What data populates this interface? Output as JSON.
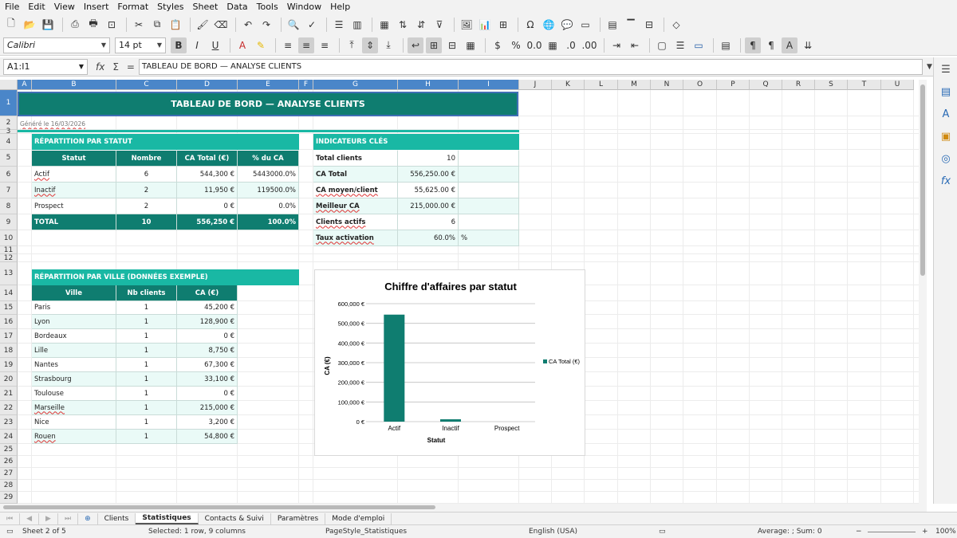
{
  "menu": [
    "File",
    "Edit",
    "View",
    "Insert",
    "Format",
    "Styles",
    "Sheet",
    "Data",
    "Tools",
    "Window",
    "Help"
  ],
  "toolbar": {
    "font_name": "Calibri",
    "font_size": "14 pt"
  },
  "formula_bar": {
    "name_box": "A1:I1",
    "content": "TABLEAU DE BORD — ANALYSE CLIENTS"
  },
  "columns": [
    "A",
    "B",
    "C",
    "D",
    "E",
    "F",
    "G",
    "H",
    "I",
    "J",
    "K",
    "L",
    "M",
    "N",
    "O",
    "P",
    "Q",
    "R",
    "S",
    "T",
    "U"
  ],
  "rows": [
    "1",
    "2",
    "3",
    "4",
    "5",
    "6",
    "7",
    "8",
    "9",
    "10",
    "11",
    "12",
    "13",
    "14",
    "15",
    "16",
    "17",
    "18",
    "19",
    "20",
    "21",
    "22",
    "23",
    "24",
    "25",
    "26",
    "27",
    "28",
    "29"
  ],
  "title": "TABLEAU DE BORD — ANALYSE CLIENTS",
  "generated": "Généré le 16/03/2026",
  "status_table": {
    "title": "RÉPARTITION PAR STATUT",
    "headers": [
      "Statut",
      "Nombre",
      "CA Total (€)",
      "% du CA"
    ],
    "rows": [
      [
        "Actif",
        "6",
        "544,300 €",
        "5443000.0%"
      ],
      [
        "Inactif",
        "2",
        "11,950 €",
        "119500.0%"
      ],
      [
        "Prospect",
        "2",
        "0 €",
        "0.0%"
      ]
    ],
    "total": [
      "TOTAL",
      "10",
      "556,250 €",
      "100.0%"
    ]
  },
  "kpi": {
    "title": "INDICATEURS CLÉS",
    "rows": [
      [
        "Total clients",
        "10",
        ""
      ],
      [
        "CA Total",
        "556,250.00 €",
        ""
      ],
      [
        "CA moyen/client",
        "55,625.00 €",
        ""
      ],
      [
        "Meilleur CA",
        "215,000.00 €",
        ""
      ],
      [
        "Clients actifs",
        "6",
        ""
      ],
      [
        "Taux activation",
        "60.0%",
        "%"
      ]
    ]
  },
  "city_table": {
    "title": "RÉPARTITION PAR VILLE (DONNÉES EXEMPLE)",
    "headers": [
      "Ville",
      "Nb clients",
      "CA (€)"
    ],
    "rows": [
      [
        "Paris",
        "1",
        "45,200 €"
      ],
      [
        "Lyon",
        "1",
        "128,900 €"
      ],
      [
        "Bordeaux",
        "1",
        "0 €"
      ],
      [
        "Lille",
        "1",
        "8,750 €"
      ],
      [
        "Nantes",
        "1",
        "67,300 €"
      ],
      [
        "Strasbourg",
        "1",
        "33,100 €"
      ],
      [
        "Toulouse",
        "1",
        "0 €"
      ],
      [
        "Marseille",
        "1",
        "215,000 €"
      ],
      [
        "Nice",
        "1",
        "3,200 €"
      ],
      [
        "Rouen",
        "1",
        "54,800 €"
      ]
    ]
  },
  "chart_data": {
    "type": "bar",
    "title": "Chiffre d'affaires par statut",
    "categories": [
      "Actif",
      "Inactif",
      "Prospect"
    ],
    "series": [
      {
        "name": "CA Total (€)",
        "values": [
          544300,
          11950,
          0
        ]
      }
    ],
    "xlabel": "Statut",
    "ylabel": "CA (€)",
    "ylim": [
      0,
      600000
    ],
    "yticks": [
      "0 €",
      "100,000 €",
      "200,000 €",
      "300,000 €",
      "400,000 €",
      "500,000 €",
      "600,000 €"
    ],
    "grid": true,
    "legend": "right",
    "color": "#0f7d70"
  },
  "sheet_tabs": [
    "Clients",
    "Statistiques",
    "Contacts & Suivi",
    "Paramètres",
    "Mode d'emploi"
  ],
  "status": {
    "sheet": "Sheet 2 of 5",
    "selection": "Selected: 1 row, 9 columns",
    "page_style": "PageStyle_Statistiques",
    "language": "English (USA)",
    "sum": "Average: ; Sum: 0",
    "zoom": "100%"
  }
}
